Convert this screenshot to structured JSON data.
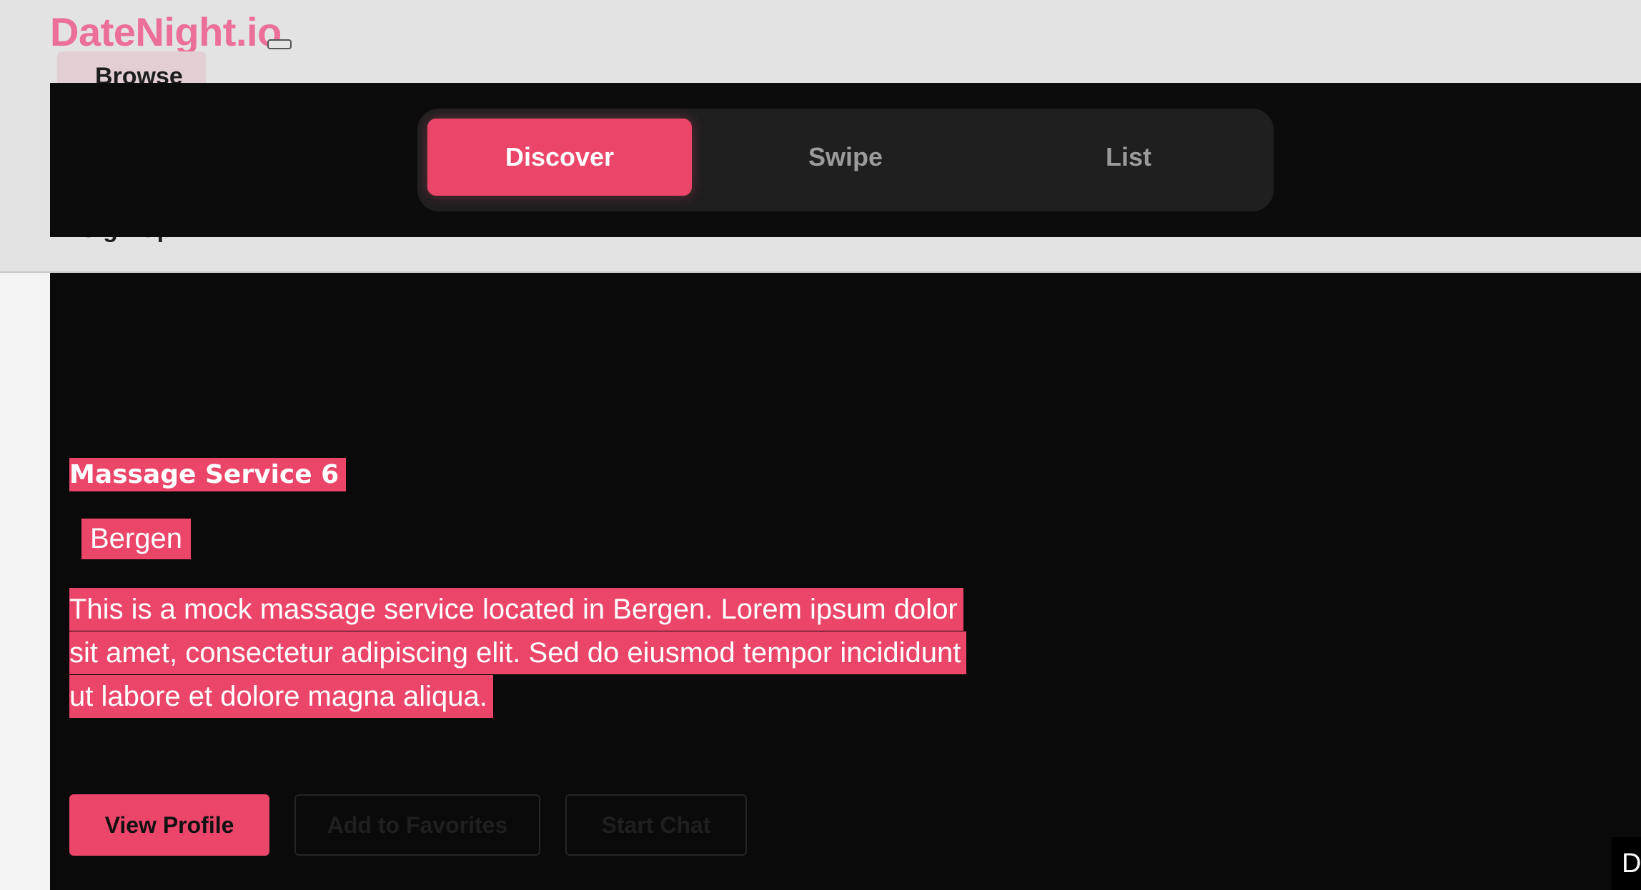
{
  "app": {
    "logo": "DateNight.io",
    "nav": {
      "browse": "Browse",
      "sign_up": "Sign Up"
    }
  },
  "view_switcher": {
    "tabs": [
      {
        "label": "Discover",
        "active": true
      },
      {
        "label": "Swipe",
        "active": false
      },
      {
        "label": "List",
        "active": false
      }
    ]
  },
  "listing": {
    "title": "Massage Service 6",
    "city": "Bergen",
    "description": "This is a mock massage service located in Bergen. Lorem ipsum dolor sit amet, consectetur adipiscing elit. Sed do eiusmod tempor incididunt ut labore et dolore magna aliqua.",
    "actions": {
      "view_profile": "View Profile",
      "add_favorites": "Add to Favorites",
      "start_chat": "Start Chat"
    }
  },
  "corner_badge": "D",
  "colors": {
    "accent": "#eb466a",
    "logo": "#ec6f9a",
    "panel_bg": "#0a0a0a",
    "header_bg": "#e3e3e3"
  }
}
